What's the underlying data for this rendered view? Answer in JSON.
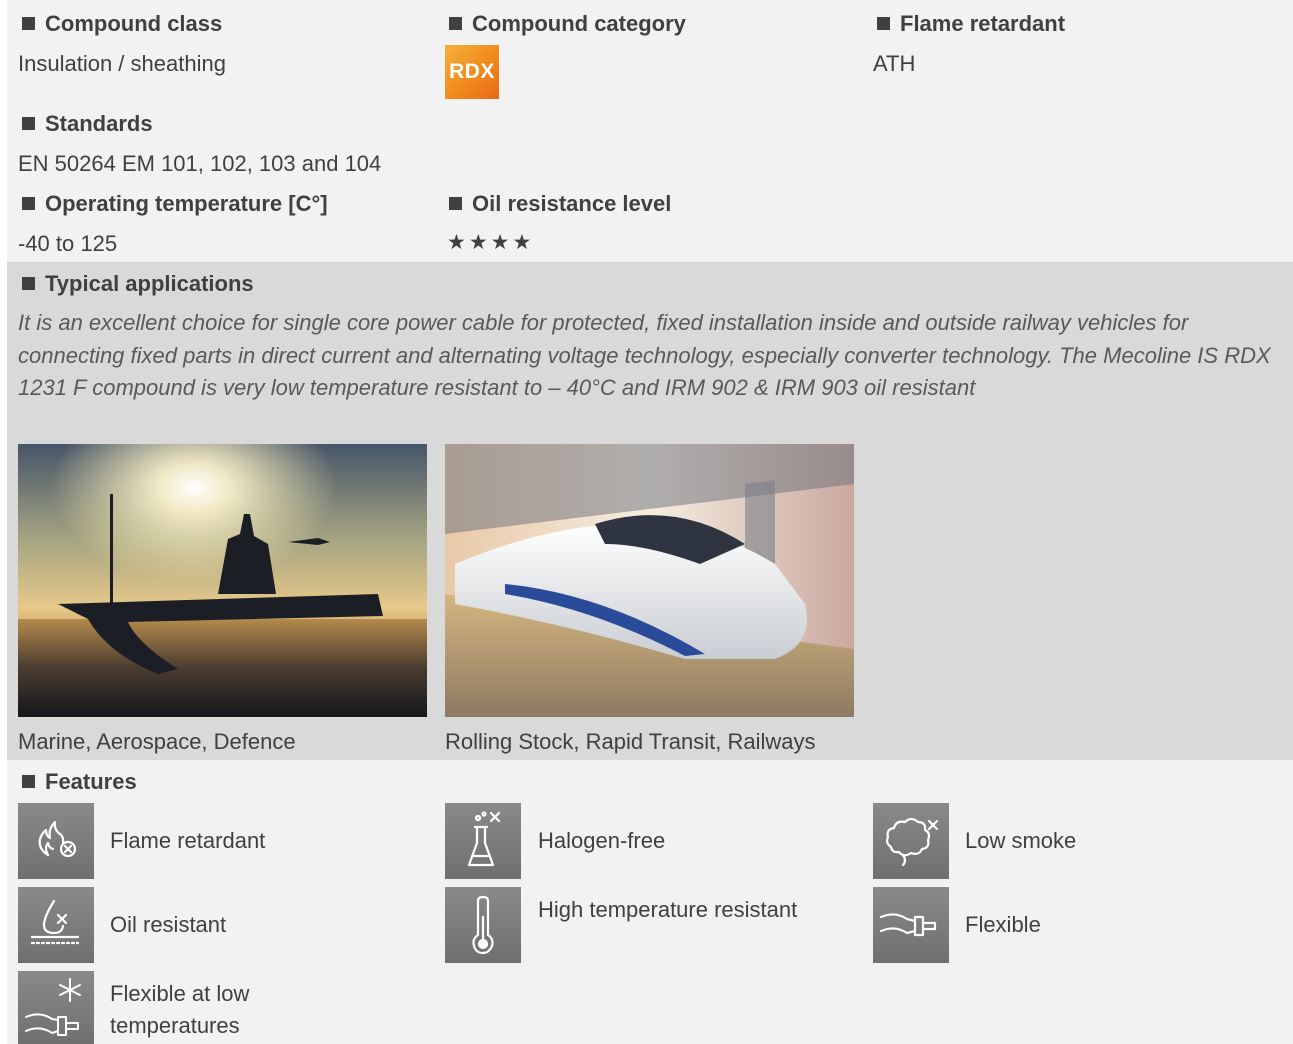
{
  "header": {
    "compound_class": {
      "title": "Compound class",
      "value": "Insulation / sheathing"
    },
    "compound_category": {
      "title": "Compound category",
      "badge": "RDX",
      "badge_color": "#f08a1c"
    },
    "flame_retardant": {
      "title": "Flame retardant",
      "value": "ATH"
    },
    "standards": {
      "title": "Standards",
      "value": "EN 50264 EM 101, 102, 103 and 104"
    },
    "operating_temperature": {
      "title": "Operating temperature [C°]",
      "value": "-40 to 125"
    },
    "oil_resistance": {
      "title": "Oil resistance level",
      "stars": "★★★★",
      "rating": 4
    }
  },
  "applications": {
    "title": "Typical applications",
    "description": "It is an excellent choice for single core power cable for protected, fixed installation inside and outside railway vehicles for connecting fixed parts in direct current and alternating voltage technology, especially converter technology. The Mecoline IS RDX 1231 F compound is very low temperature resistant to – 40°C and IRM 902 & IRM 903 oil resistant",
    "images": [
      {
        "caption": "Marine, Aerospace, Defence",
        "icon": "warship-sunset-photo"
      },
      {
        "caption": "Rolling Stock, Rapid Transit, Railways",
        "icon": "high-speed-train-photo"
      }
    ]
  },
  "features": {
    "title": "Features",
    "items": [
      {
        "label": "Flame retardant",
        "icon": "flame-retardant-icon"
      },
      {
        "label": "Halogen-free",
        "icon": "halogen-free-icon"
      },
      {
        "label": "Low smoke",
        "icon": "low-smoke-icon"
      },
      {
        "label": "Oil resistant",
        "icon": "oil-resistant-icon"
      },
      {
        "label": "High temperature resistant",
        "icon": "high-temperature-icon"
      },
      {
        "label": "Flexible",
        "icon": "flexible-icon"
      },
      {
        "label": "Flexible at low temperatures",
        "icon": "flexible-low-temp-icon"
      }
    ]
  },
  "colors": {
    "text": "#404040",
    "band_light": "#f2f2f2",
    "band_dark": "#d9d9d9",
    "icon_bg": "#7a7a7a"
  }
}
